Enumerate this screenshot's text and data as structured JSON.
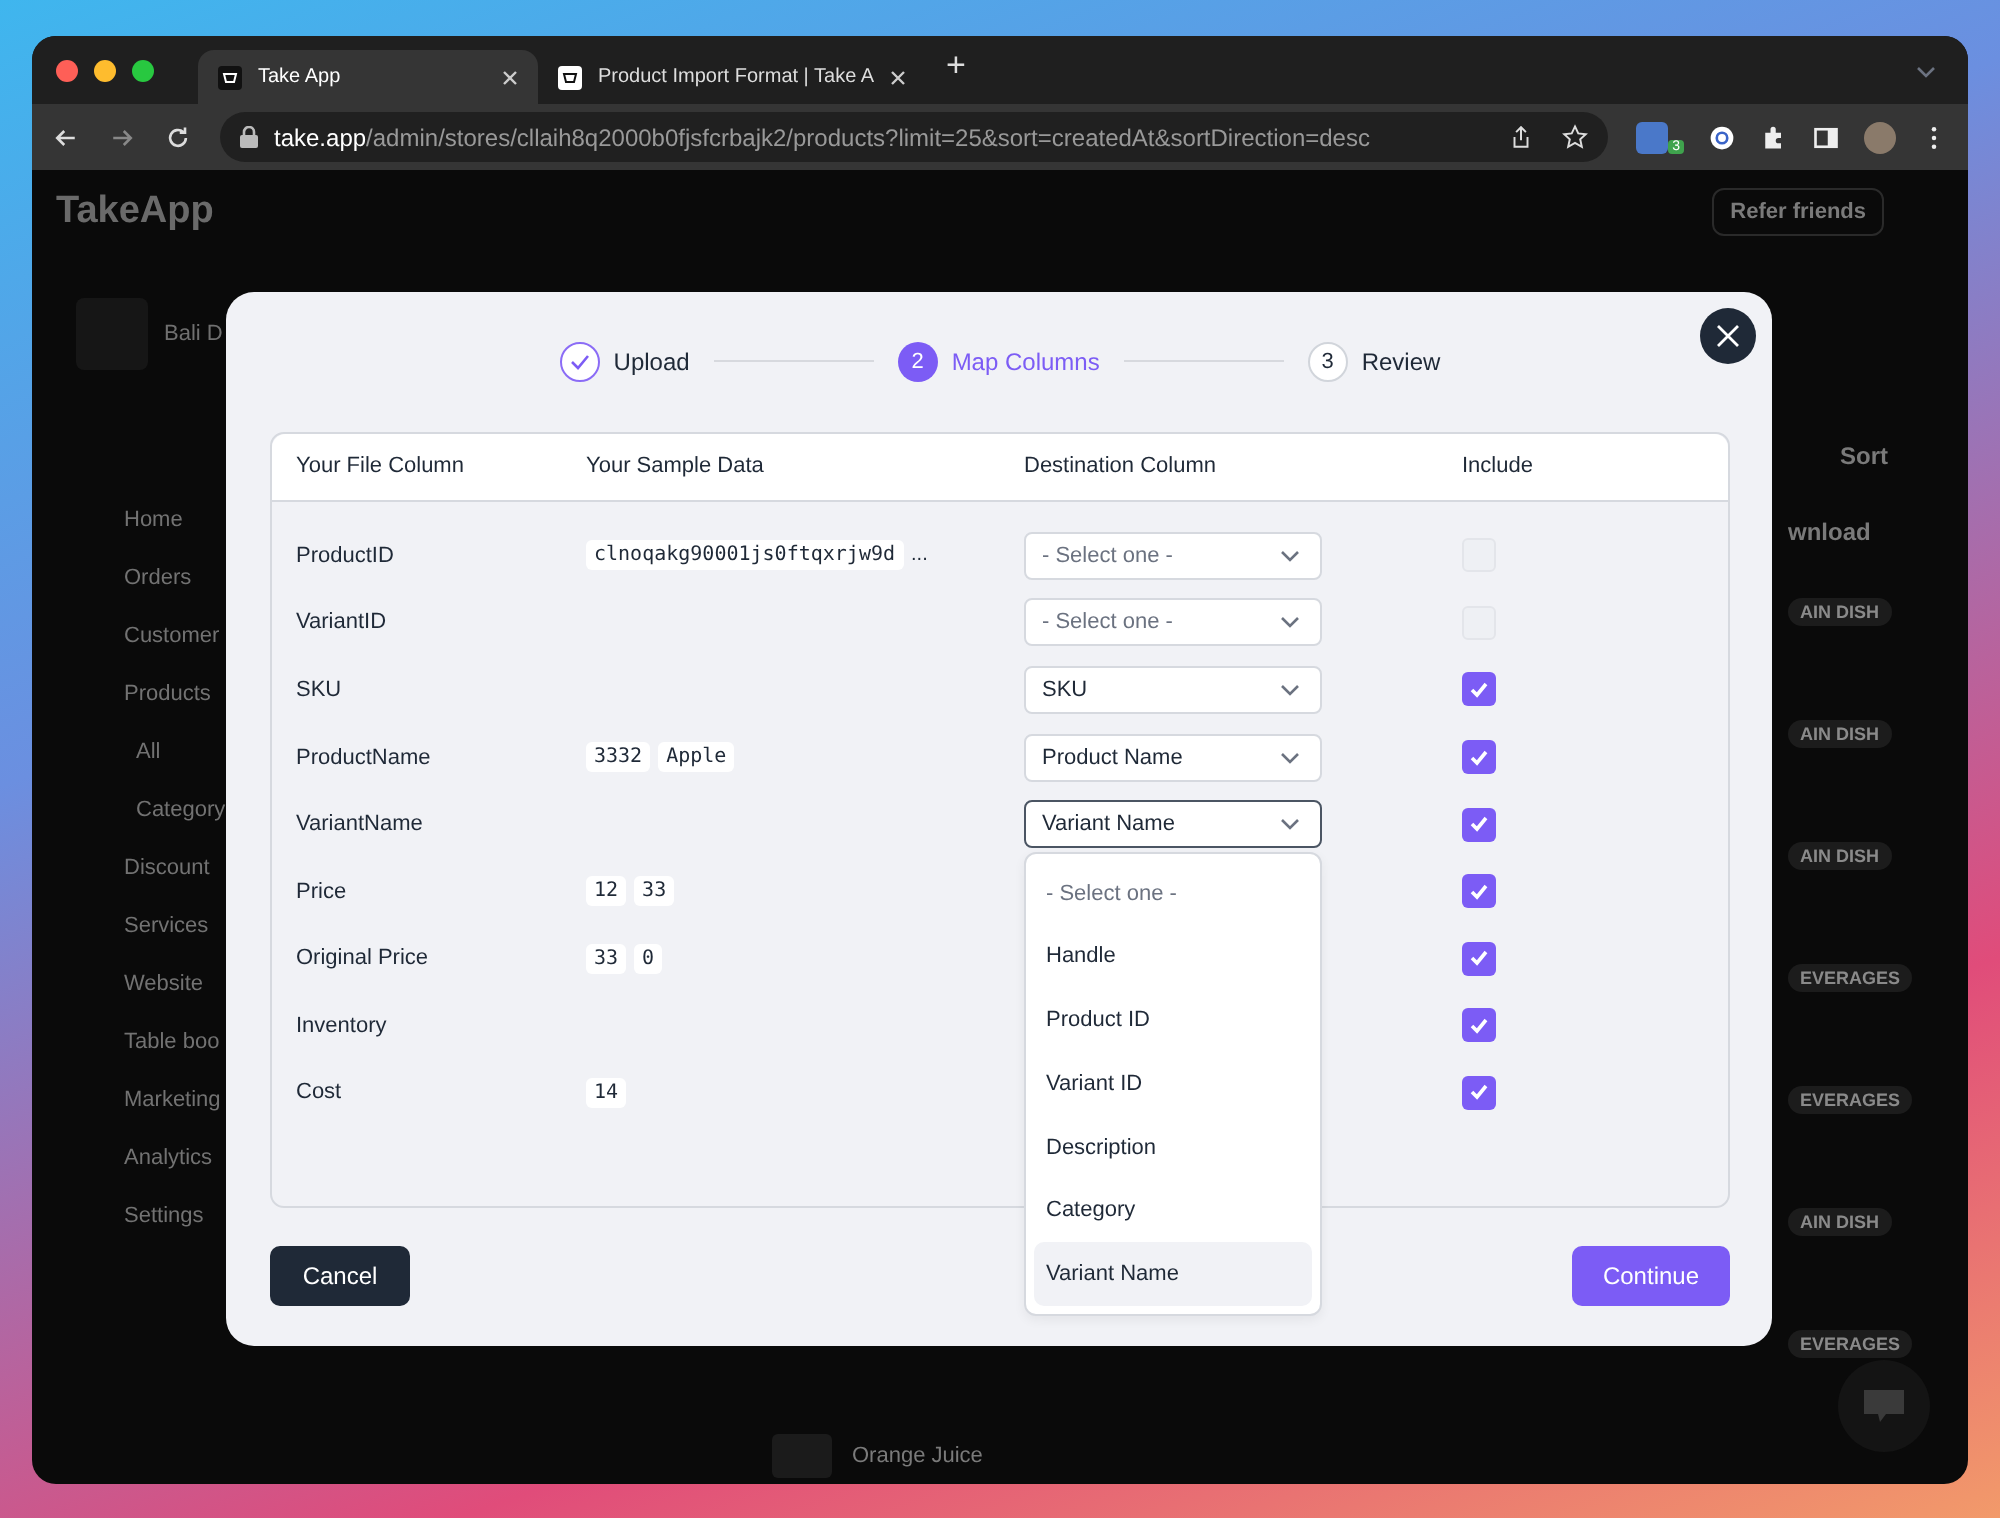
{
  "browser": {
    "tabs": [
      {
        "title": "Take App",
        "selected": true
      },
      {
        "title": "Product Import Format | Take A",
        "selected": false
      }
    ],
    "new_tab": "+",
    "url_host": "take.app",
    "url_path": "/admin/stores/cllaih8q2000b0fjsfcrbajk2/products?limit=25&sort=createdAt&sortDirection=desc",
    "extension_badge": "3"
  },
  "app": {
    "logo": "TakeApp",
    "refer": "Refer friends",
    "store_name": "Bali D",
    "sidebar": [
      {
        "label": "Home",
        "sub": false
      },
      {
        "label": "Orders",
        "sub": false
      },
      {
        "label": "Customer",
        "sub": false
      },
      {
        "label": "Products",
        "sub": false
      },
      {
        "label": "All",
        "sub": true
      },
      {
        "label": "Category",
        "sub": true
      },
      {
        "label": "Discount",
        "sub": false
      },
      {
        "label": "Services",
        "sub": false
      },
      {
        "label": "Website",
        "sub": false
      },
      {
        "label": "Table boo",
        "sub": false
      },
      {
        "label": "Marketing",
        "sub": false
      },
      {
        "label": "Analytics",
        "sub": false
      },
      {
        "label": "Settings",
        "sub": false
      }
    ],
    "sort": "Sort",
    "download": "wnload",
    "tags": [
      "AIN DISH",
      "AIN DISH",
      "AIN DISH",
      "EVERAGES",
      "EVERAGES",
      "AIN DISH",
      "EVERAGES"
    ],
    "last_product": "Orange Juice"
  },
  "modal": {
    "steps": [
      {
        "label": "Upload",
        "completed": true,
        "current": false
      },
      {
        "number": "2",
        "label": "Map Columns",
        "completed": false,
        "current": true
      },
      {
        "number": "3",
        "label": "Review",
        "completed": false,
        "current": false
      }
    ],
    "columns": [
      "Your File Column",
      "Your Sample Data",
      "Destination Column",
      "Include"
    ],
    "rows": [
      {
        "file_column": "ProductID",
        "samples": [
          "clnoqakg90001js0ftqxrjw9d"
        ],
        "more": "...",
        "destination": "- Select one -",
        "empty": true,
        "open": false,
        "checked": false
      },
      {
        "file_column": "VariantID",
        "samples": [],
        "destination": "- Select one -",
        "empty": true,
        "open": false,
        "checked": false
      },
      {
        "file_column": "SKU",
        "samples": [],
        "destination": "SKU",
        "empty": false,
        "open": false,
        "checked": true
      },
      {
        "file_column": "ProductName",
        "samples": [
          "3332",
          "Apple"
        ],
        "destination": "Product Name",
        "empty": false,
        "open": false,
        "checked": true
      },
      {
        "file_column": "VariantName",
        "samples": [],
        "destination": "Variant Name",
        "empty": false,
        "open": true,
        "checked": true
      },
      {
        "file_column": "Price",
        "samples": [
          "12",
          "33"
        ],
        "checked": true
      },
      {
        "file_column": "Original Price",
        "samples": [
          "33",
          "0"
        ],
        "checked": true
      },
      {
        "file_column": "Inventory",
        "samples": [],
        "checked": true
      },
      {
        "file_column": "Cost",
        "samples": [
          "14"
        ],
        "checked": true
      }
    ],
    "options": [
      {
        "label": "- Select one -",
        "kind": "placeholder",
        "selected": false
      },
      {
        "label": "Handle",
        "kind": "option",
        "selected": false
      },
      {
        "label": "Product ID",
        "kind": "option",
        "selected": false
      },
      {
        "label": "Variant ID",
        "kind": "option",
        "selected": false
      },
      {
        "label": "Description",
        "kind": "option",
        "selected": false
      },
      {
        "label": "Category",
        "kind": "option",
        "selected": false
      },
      {
        "label": "Variant Name",
        "kind": "option",
        "selected": true
      }
    ],
    "cancel": "Cancel",
    "continue": "Continue"
  }
}
